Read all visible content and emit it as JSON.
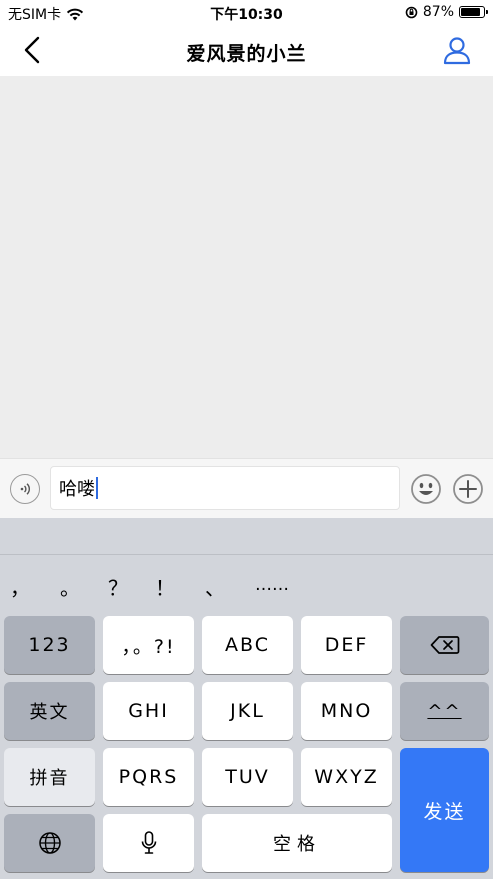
{
  "status_bar": {
    "carrier": "无SIM卡",
    "time": "下午10:30",
    "battery_percent": "87%",
    "battery_level": 0.87
  },
  "nav": {
    "title": "爱风景的小兰",
    "back_icon": "chevron-left-icon",
    "profile_icon": "person-icon"
  },
  "input_bar": {
    "text_value": "哈喽",
    "voice_icon": "voice-icon",
    "emoji_icon": "emoji-icon",
    "plus_icon": "plus-icon"
  },
  "keyboard": {
    "punctuation": [
      "，",
      "。",
      "？",
      "！",
      "、",
      "……"
    ],
    "keys": {
      "num": "123",
      "punct": "，。?!",
      "abc": "ABC",
      "def": "DEF",
      "english": "英文",
      "ghi": "GHI",
      "jkl": "JKL",
      "mno": "MNO",
      "face": "^^",
      "pinyin": "拼音",
      "pqrs": "PQRS",
      "tuv": "TUV",
      "wxyz": "WXYZ",
      "space": "空格",
      "send": "发送"
    },
    "send_color": "#3478f6"
  }
}
